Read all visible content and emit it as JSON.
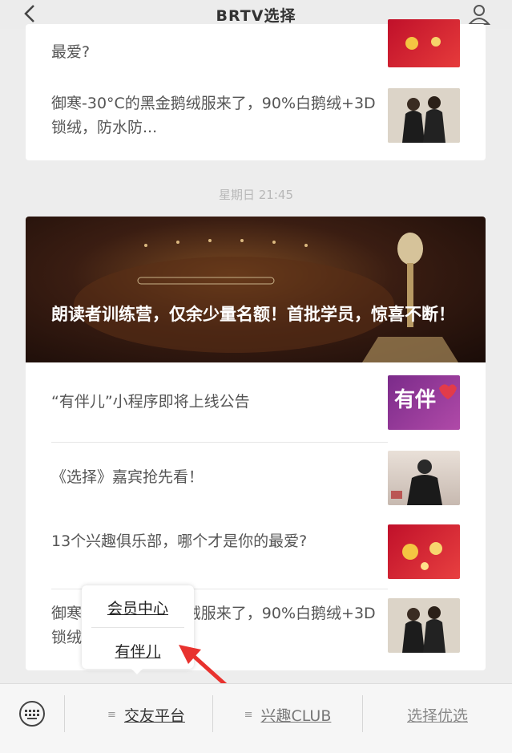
{
  "header": {
    "title": "BRTV选择"
  },
  "card_top": {
    "items": [
      {
        "text": "最爱?"
      },
      {
        "text": "御寒-30°C的黑金鹅绒服来了，90%白鹅绒+3D锁绒，防水防..."
      }
    ]
  },
  "timestamp": "星期日 21:45",
  "banner": {
    "title": "朗读者训练营，仅余少量名额！首批学员，惊喜不断！"
  },
  "articles": [
    {
      "text": "“有伴儿”小程序即将上线公告",
      "thumb_text": "有伴"
    },
    {
      "text": "《选择》嘉宾抢先看！"
    },
    {
      "text": "13个兴趣俱乐部，哪个才是你的最爱?"
    },
    {
      "text": "御寒-30°C的黑金鹅绒服来了，90%白鹅绒+3D锁绒，防水防..."
    }
  ],
  "popup": {
    "items": [
      "会员中心",
      "有伴儿"
    ]
  },
  "bottom_menu": {
    "items": [
      {
        "label": "交友平台"
      },
      {
        "label": "兴趣CLUB"
      },
      {
        "label": "选择优选"
      }
    ]
  },
  "colors": {
    "arrow": "#e8322e",
    "background": "#ededed",
    "banner_dark": "#2a140c"
  }
}
